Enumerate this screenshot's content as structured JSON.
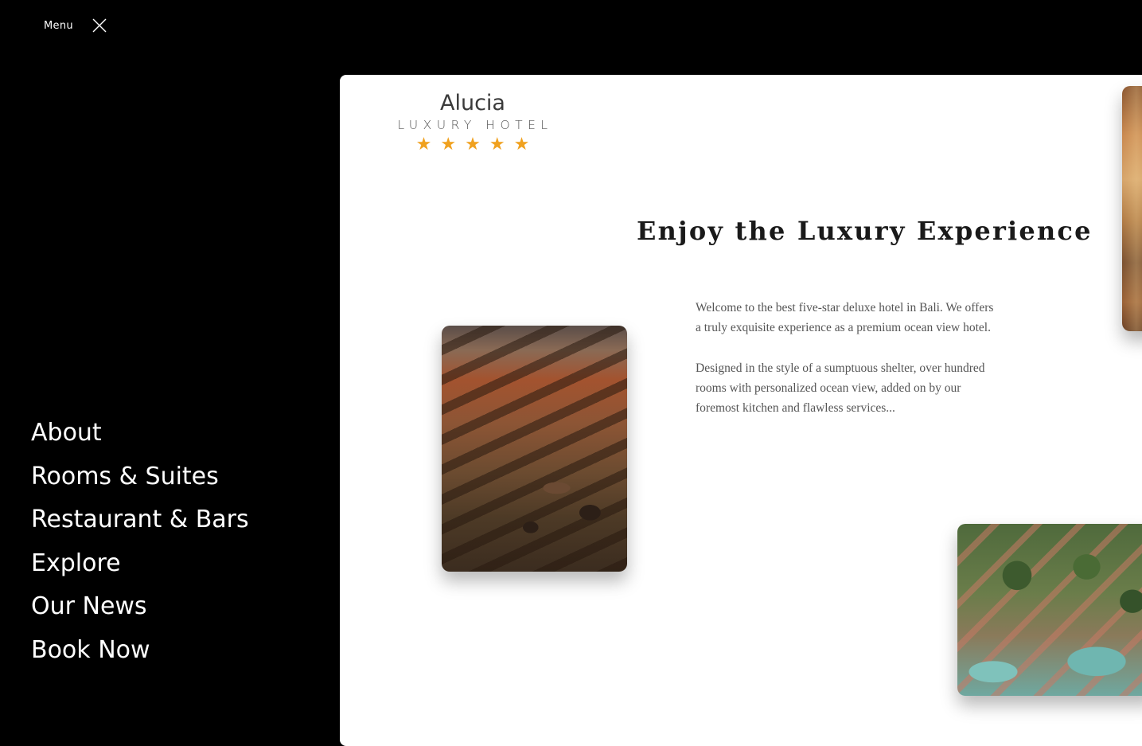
{
  "menu": {
    "label": "Menu",
    "close_icon": "close-icon"
  },
  "nav": {
    "items": [
      {
        "label": "About"
      },
      {
        "label": "Rooms & Suites"
      },
      {
        "label": "Restaurant & Bars"
      },
      {
        "label": "Explore"
      },
      {
        "label": "Our News"
      },
      {
        "label": "Book Now"
      }
    ]
  },
  "logo": {
    "name": "Alucia",
    "tagline": "LUXURY HOTEL",
    "star_rating": 5,
    "star_icon": "star-icon",
    "star_color": "#f0a11f"
  },
  "main": {
    "headline": "Enjoy the Luxury Experience",
    "paragraphs": [
      "Welcome to the best five-star deluxe hotel in Bali. We offers a truly exquisite experience as a premium ocean view hotel.",
      "Designed in the style of a sumptuous shelter, over hundred rooms with personalized ocean view, added on by our foremost kitchen and flawless services..."
    ]
  },
  "colors": {
    "menu_background": "#000000",
    "panel_background": "#ffffff",
    "accent": "#f0a11f"
  }
}
